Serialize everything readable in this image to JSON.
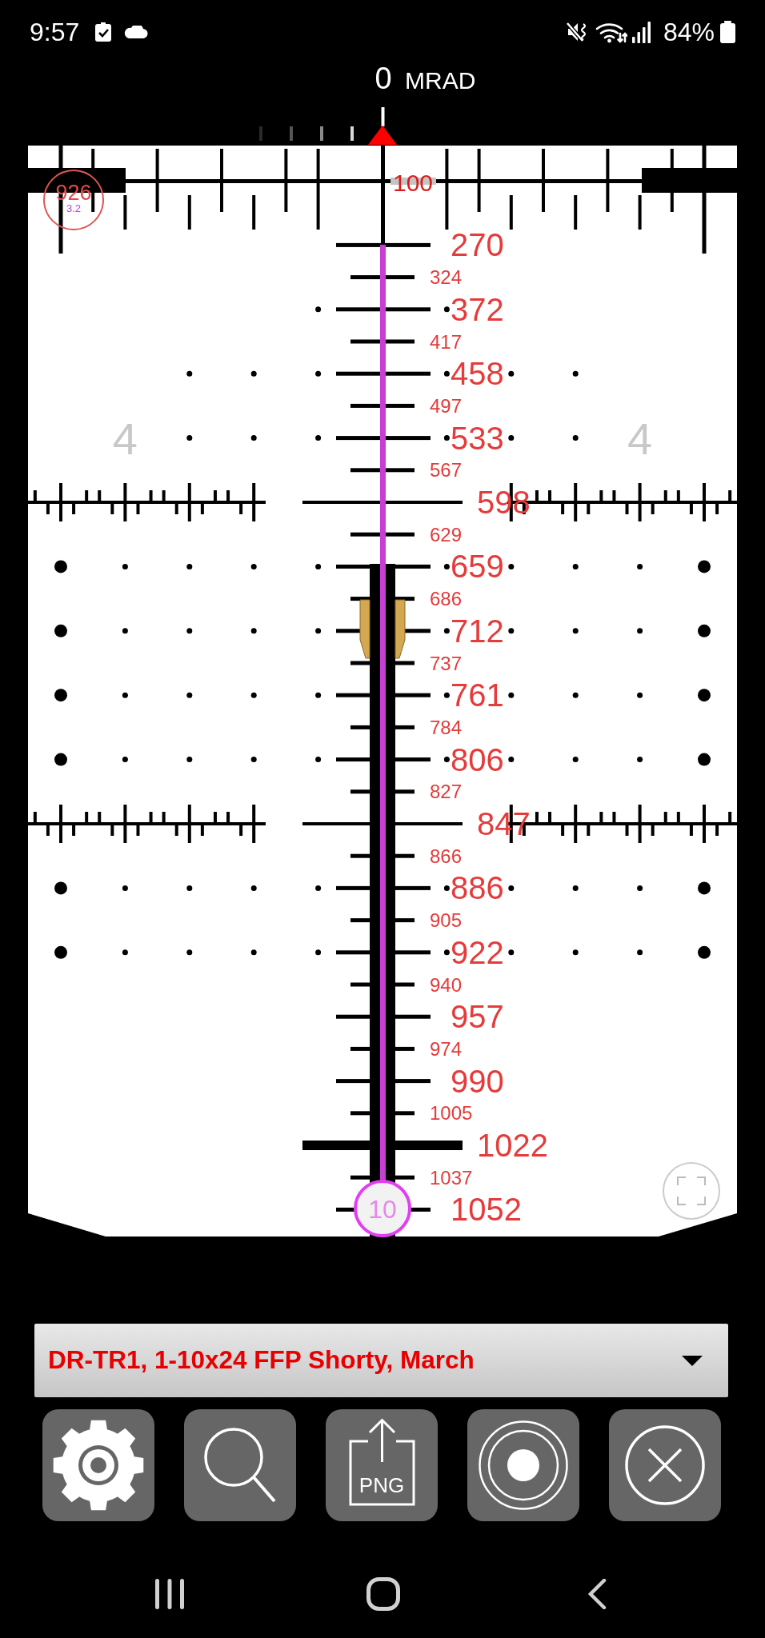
{
  "status_bar": {
    "time": "9:57",
    "battery": "84%"
  },
  "scale_header": {
    "value": "0",
    "unit": "MRAD"
  },
  "reticle": {
    "corner_badge": {
      "value": "926",
      "subvalue": "3.2"
    },
    "ruler_label": "100",
    "side_labels": [
      "4",
      "4"
    ],
    "range_marks": [
      {
        "text": "270",
        "kind": "major"
      },
      {
        "text": "324",
        "kind": "minor"
      },
      {
        "text": "372",
        "kind": "major"
      },
      {
        "text": "417",
        "kind": "minor"
      },
      {
        "text": "458",
        "kind": "major"
      },
      {
        "text": "497",
        "kind": "minor"
      },
      {
        "text": "533",
        "kind": "major"
      },
      {
        "text": "567",
        "kind": "minor"
      },
      {
        "text": "598",
        "kind": "stadia"
      },
      {
        "text": "629",
        "kind": "minor"
      },
      {
        "text": "659",
        "kind": "major"
      },
      {
        "text": "686",
        "kind": "minor"
      },
      {
        "text": "712",
        "kind": "major"
      },
      {
        "text": "737",
        "kind": "minor"
      },
      {
        "text": "761",
        "kind": "major"
      },
      {
        "text": "784",
        "kind": "minor"
      },
      {
        "text": "806",
        "kind": "major"
      },
      {
        "text": "827",
        "kind": "minor"
      },
      {
        "text": "847",
        "kind": "stadia"
      },
      {
        "text": "866",
        "kind": "minor"
      },
      {
        "text": "886",
        "kind": "major"
      },
      {
        "text": "905",
        "kind": "minor"
      },
      {
        "text": "922",
        "kind": "major"
      },
      {
        "text": "940",
        "kind": "minor"
      },
      {
        "text": "957",
        "kind": "major"
      },
      {
        "text": "974",
        "kind": "minor"
      },
      {
        "text": "990",
        "kind": "major"
      },
      {
        "text": "1005",
        "kind": "minor"
      },
      {
        "text": "1022",
        "kind": "bar"
      },
      {
        "text": "1037",
        "kind": "minor"
      },
      {
        "text": "1052",
        "kind": "major"
      }
    ],
    "magnification_knob": "10"
  },
  "profile_dropdown": {
    "value": "DR-TR1, 1-10x24 FFP Shorty, March"
  },
  "toolbar": {
    "export_label": "PNG"
  }
}
